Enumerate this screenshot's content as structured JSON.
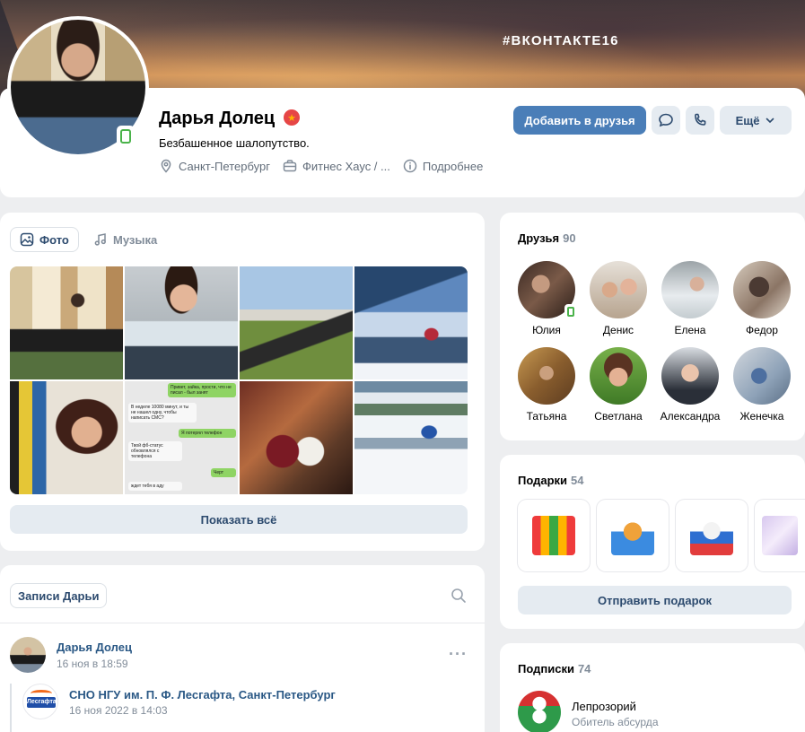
{
  "cover": {
    "hashtag": "#ВКОНТАКТЕ16"
  },
  "profile": {
    "name": "Дарья Долец",
    "status": "Безбашенное шалопутство.",
    "city": "Санкт-Петербург",
    "work": "Фитнес Хаус / ...",
    "more_info": "Подробнее"
  },
  "actions": {
    "add_friend": "Добавить в друзья",
    "more": "Ещё"
  },
  "media": {
    "tabs": [
      {
        "label": "Фото"
      },
      {
        "label": "Музыка"
      }
    ],
    "show_all": "Показать всё",
    "chat_photo": {
      "bubble1": "Привет, зайка, прости, что не писал - был занят",
      "bubble2": "В неделе 10080 минут, и ты не нашел одну, чтобы написать СМС?",
      "bubble3": "Я потерял телефон",
      "bubble4": "Твой фб-статус обновлялся с телефона",
      "bubble5": "Черт",
      "bubble6": "ждет тебя в аду"
    }
  },
  "friends": {
    "title": "Друзья",
    "count": "90",
    "items": [
      {
        "name": "Юлия"
      },
      {
        "name": "Денис"
      },
      {
        "name": "Елена"
      },
      {
        "name": "Федор"
      },
      {
        "name": "Татьяна"
      },
      {
        "name": "Светлана"
      },
      {
        "name": "Александра"
      },
      {
        "name": "Женечка"
      }
    ]
  },
  "gifts": {
    "title": "Подарки",
    "count": "54",
    "send": "Отправить подарок"
  },
  "subscriptions": {
    "title": "Подписки",
    "count": "74",
    "items": [
      {
        "name": "Лепрозорий",
        "desc": "Обитель абсурда"
      }
    ]
  },
  "wall": {
    "tab": "Записи Дарьи",
    "post": {
      "author": "Дарья Долец",
      "date": "16 ноя в 18:59",
      "repost_source": "СНО НГУ им. П. Ф. Лесгафта, Санкт-Петербург",
      "repost_date": "16 ноя 2022 в 14:03",
      "repost_logo": "Лесгафта"
    }
  }
}
